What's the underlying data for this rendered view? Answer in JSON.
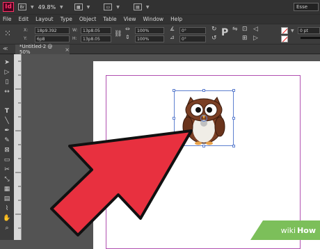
{
  "app": {
    "logo": "Id",
    "br_label": "Br",
    "zoom": "49.8%",
    "workspace": "Esse"
  },
  "menu": [
    "File",
    "Edit",
    "Layout",
    "Type",
    "Object",
    "Table",
    "View",
    "Window",
    "Help"
  ],
  "control": {
    "x": "18p9.392",
    "y": "6p8",
    "w": "13p8.05",
    "h": "13p8.05",
    "scale_x": "100%",
    "scale_y": "100%",
    "angle": "0°",
    "shear": "0°",
    "stroke_weight": "0 pt",
    "x_label": "X:",
    "y_label": "Y:",
    "w_label": "W:",
    "h_label": "H:"
  },
  "tab": {
    "title": "*Untitled-2 @ 50%",
    "close": "×"
  },
  "watermark": {
    "wiki": "wiki",
    "how": "How"
  },
  "colors": {
    "arrow_fill": "#e8303f",
    "arrow_stroke": "#111111",
    "margin": "#b04fb0",
    "selection": "#5d7fcf",
    "owl_brown": "#7a3f24",
    "watermark_green": "#7cbf5a"
  },
  "icons": [
    "selection-tool-icon",
    "direct-selection-tool-icon",
    "page-tool-icon",
    "gap-tool-icon",
    "type-tool-icon",
    "line-tool-icon",
    "pen-tool-icon",
    "pencil-tool-icon",
    "rectangle-frame-tool-icon",
    "rectangle-tool-icon",
    "scissors-tool-icon",
    "free-transform-tool-icon",
    "gradient-tool-icon",
    "note-tool-icon",
    "eyedropper-tool-icon",
    "hand-tool-icon",
    "zoom-tool-icon"
  ]
}
